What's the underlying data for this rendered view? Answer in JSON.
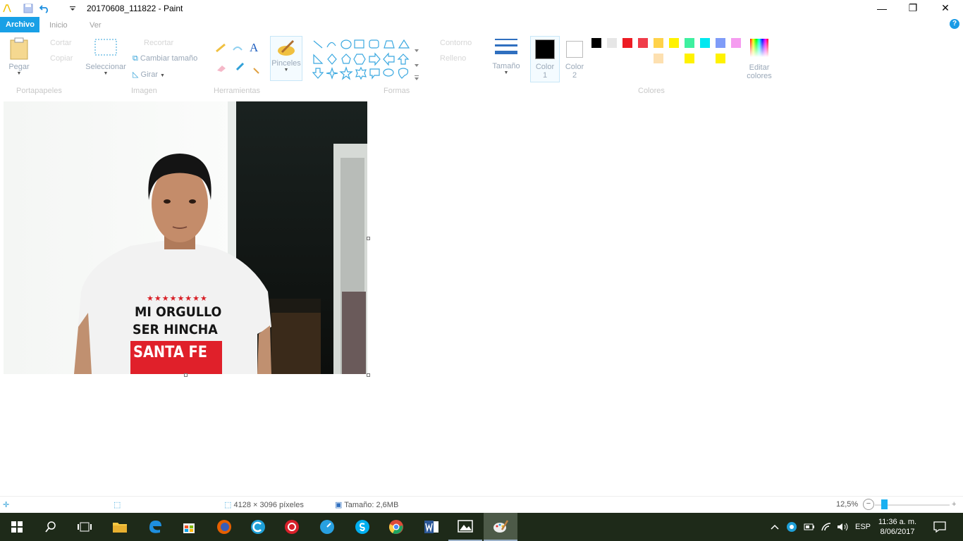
{
  "window": {
    "title": "20170608_111822 - Paint",
    "minimize_label": "—",
    "maximize_label": "❐",
    "close_label": "✕"
  },
  "tabs": [
    {
      "label": "Archivo"
    },
    {
      "label": "Inicio"
    },
    {
      "label": "Ver"
    }
  ],
  "help_label": "?",
  "ribbon": {
    "clipboard": {
      "paste": "Pegar",
      "cut": "Cortar",
      "copy": "Copiar",
      "group": "Portapapeles"
    },
    "image": {
      "select": "Seleccionar",
      "crop": "Recortar",
      "resize": "Cambiar tamaño",
      "rotate": "Girar",
      "group": "Imagen"
    },
    "tools": {
      "group": "Herramientas",
      "text_tool": "A"
    },
    "brushes": {
      "label": "Pinceles"
    },
    "shapes": {
      "outline": "Contorno",
      "fill": "Relleno",
      "group": "Formas"
    },
    "size": {
      "label": "Tamaño"
    },
    "color1": {
      "label_line1": "Color",
      "label_line2": "1"
    },
    "color2": {
      "label_line1": "Color",
      "label_line2": "2"
    },
    "colors": {
      "group": "Colores"
    },
    "edit_colors": {
      "label_line1": "Editar",
      "label_line2": "colores"
    },
    "palette_row1": [
      "#000000",
      "#e6e6e6",
      "#ed1c24",
      "#f03c4a",
      "#ffd24a",
      "#fff200",
      "#3ef0a0",
      "#00e8f0",
      "#7f9cf8",
      "#f59cf0"
    ],
    "palette_row2": [
      "#ffffff",
      "#ffffff",
      "#ffffff",
      "#ffffff",
      "#fde0b0",
      "#ffffff",
      "#fff200",
      "#ffffff",
      "#fff200",
      "#ffffff",
      "#d6f6fa",
      "#ffffff"
    ],
    "color1_value": "#000000",
    "color2_value": "#ffffff"
  },
  "photo": {
    "shirt_line1": "MI ORGULLO",
    "shirt_line2": "SER HINCHA",
    "shirt_line3": "SANTA FE",
    "stars": "★★★★★★★★"
  },
  "status": {
    "dimensions": "4128 × 3096 píxeles",
    "file_size": "Tamaño: 2,6MB",
    "zoom": "12,5%"
  },
  "taskbar": {
    "time": "11:36 a. m.",
    "date": "8/06/2017",
    "language": "ESP"
  }
}
